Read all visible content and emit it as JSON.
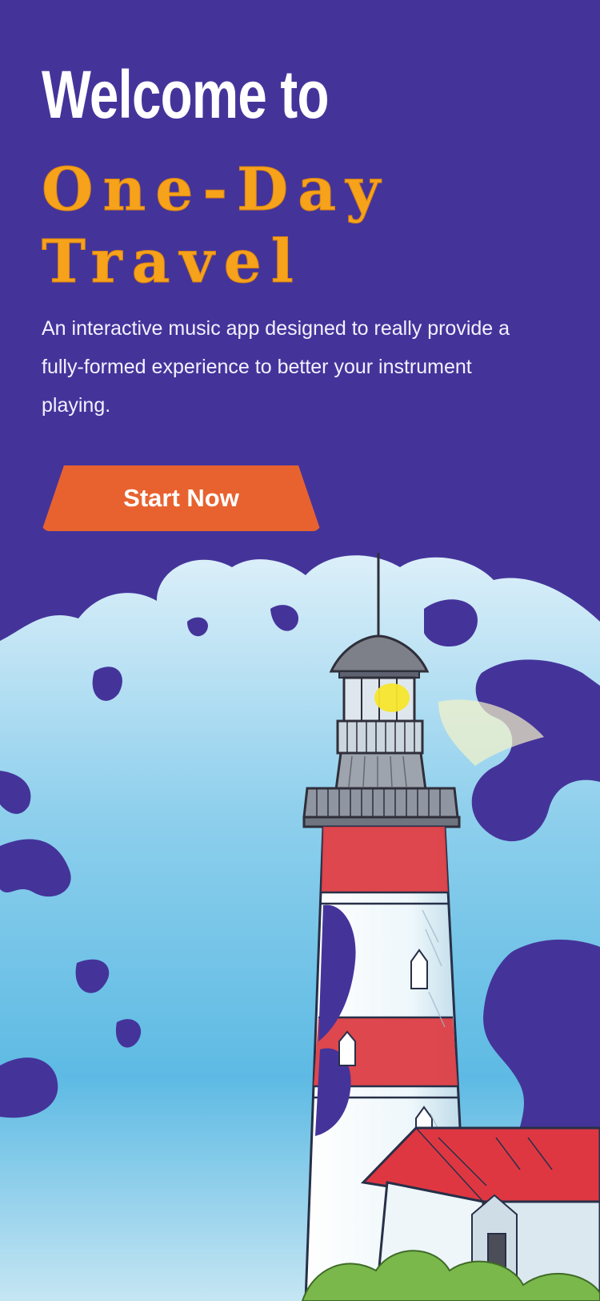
{
  "screen": {
    "title_line1": "Welcome to",
    "brand_line1": "One-Day",
    "brand_line2": "Travel",
    "description": "An interactive music app designed to really provide a fully-formed experience to better your instrument playing.",
    "cta_label": "Start Now"
  },
  "colors": {
    "background": "#44349a",
    "brand": "#f7a21b",
    "cta": "#e8622f",
    "text": "#ffffff"
  },
  "illustration": {
    "subject": "lighthouse-watercolor-illustration"
  }
}
